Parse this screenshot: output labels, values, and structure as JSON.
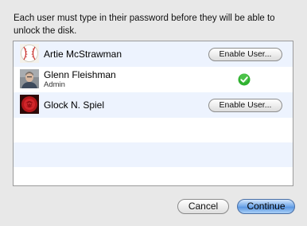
{
  "dialog": {
    "instructions": "Each user must type in their password before they will be able to unlock the disk."
  },
  "users": [
    {
      "name": "Artie McStrawman",
      "role": "",
      "avatar_icon": "baseball-icon",
      "action_label": "Enable User...",
      "enabled": false
    },
    {
      "name": "Glenn Fleishman",
      "role": "Admin",
      "avatar_icon": "user-photo",
      "action_label": "",
      "enabled": true,
      "status_icon": "checkmark-icon"
    },
    {
      "name": "Glock N. Spiel",
      "role": "",
      "avatar_icon": "red-rose-icon",
      "action_label": "Enable User...",
      "enabled": false
    }
  ],
  "buttons": {
    "cancel": "Cancel",
    "continue": "Continue"
  },
  "colors": {
    "row_alternate": "#edf3fe",
    "check_green": "#2fb12f",
    "default_button": "#5b97e2"
  }
}
